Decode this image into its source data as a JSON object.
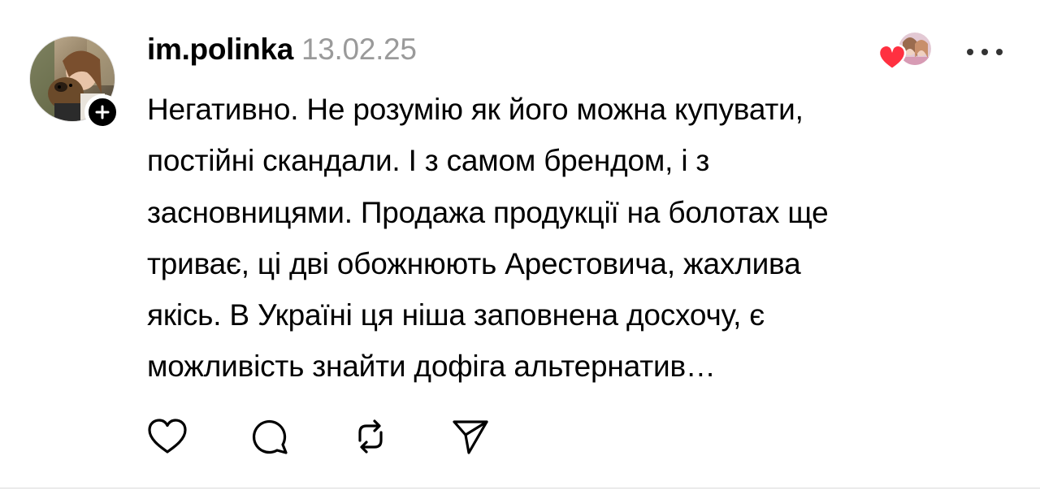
{
  "post": {
    "username": "im.polinka",
    "date": "13.02.25",
    "text_lines": [
      "Негативно. Не розумію як його можна купувати,",
      "постійні скандали. І з самом брендом, і з",
      "засновницями. Продажа продукції на болотах ще",
      "триває, ці дві обожнюють Арестовича, жахлива",
      "якісь. В Україні ця ніша заповнена досхочу, є",
      "можливість знайти дофіга альтернатив…"
    ],
    "follow_badge_icon": "plus-icon",
    "liked_by_icon": "heart-icon",
    "liked_by_color": "#ff3040",
    "more_icon": "more-horizontal-icon"
  },
  "actions": [
    {
      "name": "like",
      "icon": "heart-outline-icon"
    },
    {
      "name": "comment",
      "icon": "comment-icon"
    },
    {
      "name": "repost",
      "icon": "repost-icon"
    },
    {
      "name": "share",
      "icon": "send-icon"
    }
  ]
}
